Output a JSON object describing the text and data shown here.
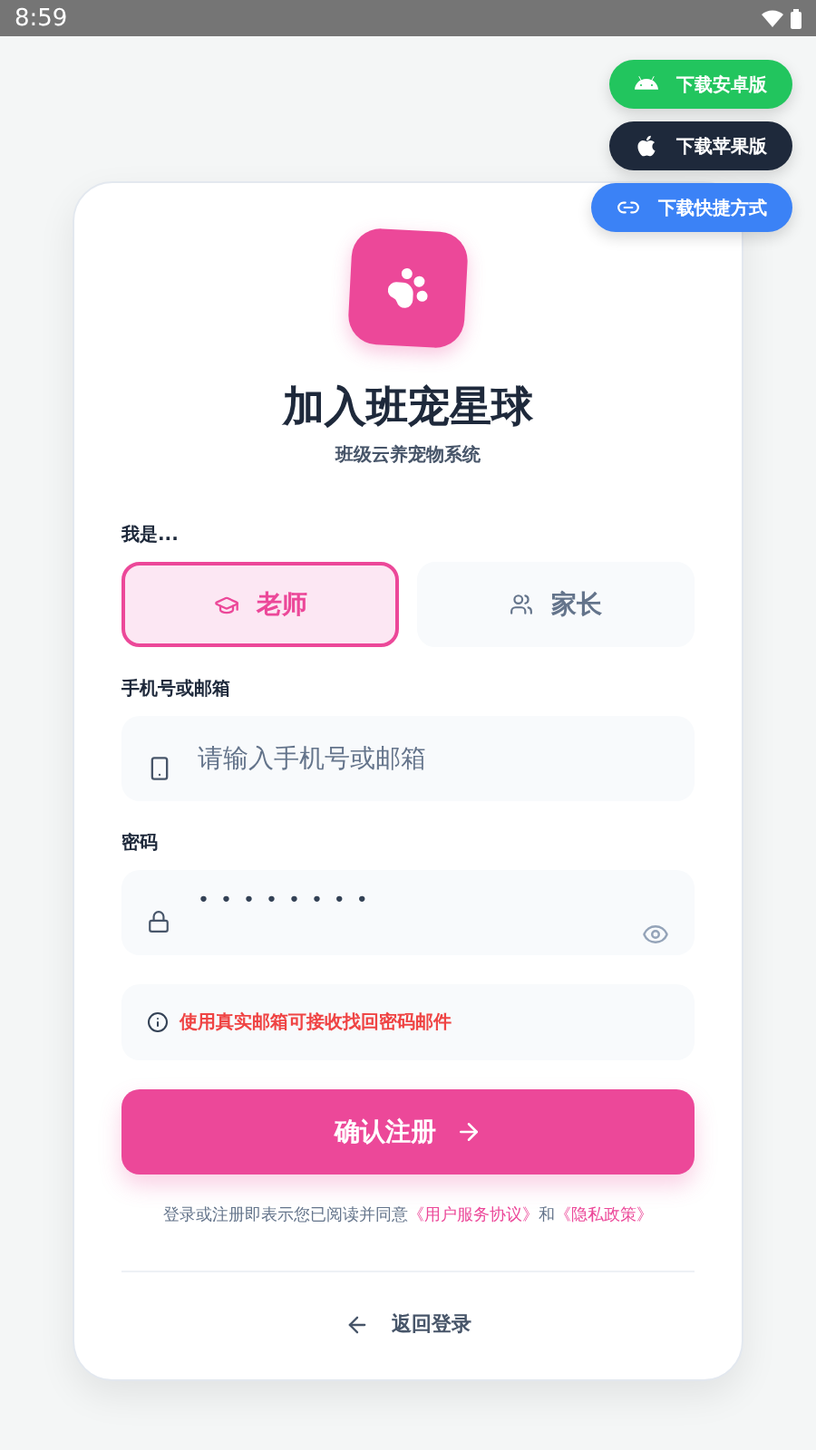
{
  "status_bar": {
    "time": "8:59"
  },
  "download_buttons": [
    {
      "kind": "android",
      "label": "下载安卓版"
    },
    {
      "kind": "apple",
      "label": "下载苹果版"
    },
    {
      "kind": "link",
      "label": "下载快捷方式"
    }
  ],
  "title": "加入班宠星球",
  "subtitle": "班级云养宠物系统",
  "role": {
    "label": "我是...",
    "options": [
      {
        "kind": "teacher",
        "label": "老师",
        "selected": true
      },
      {
        "kind": "parent",
        "label": "家长",
        "selected": false
      }
    ]
  },
  "account": {
    "label": "手机号或邮箱",
    "placeholder": "请输入手机号或邮箱"
  },
  "password": {
    "label": "密码",
    "value": "••••••••"
  },
  "notice": "使用真实邮箱可接收找回密码邮件",
  "submit": "确认注册",
  "agreement": {
    "before": "登录或注册即表示您已阅读并同意",
    "terms": "《用户服务协议》",
    "middle": "和",
    "privacy": "《隐私政策》"
  },
  "back": "返回登录"
}
